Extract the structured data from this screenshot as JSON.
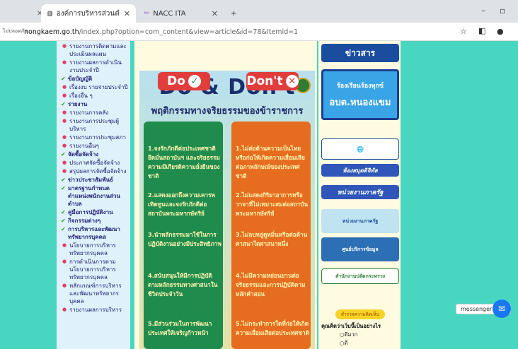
{
  "tabs": [
    {
      "label": "องค์การบริหารส่วนตำบลหนองแขม :: ...",
      "favicon": "globe-icon"
    },
    {
      "label": "NACC ITA",
      "favicon": "nacc-icon"
    }
  ],
  "address": {
    "secure_label": "ไม่ปลอดภัย",
    "host": "nongkaem.go.th",
    "path": "/index.php?option=com_content&view=article&id=78&Itemid=1"
  },
  "sidebar": {
    "items": [
      {
        "label": "รายงานการติดตามและประเมินผลแผน",
        "head": false
      },
      {
        "label": "รายงานผลการดำเนินงานประจำปี",
        "head": false
      },
      {
        "label": "ข้อบัญญัติ",
        "head": true
      },
      {
        "label": "เรื่องงบ รายจ่ายประจำปี",
        "head": false
      },
      {
        "label": "เรื่องอื่น ๆ",
        "head": false
      },
      {
        "label": "รายงาน",
        "head": true
      },
      {
        "label": "รายงานการคลัง",
        "head": false
      },
      {
        "label": "รายงานการประชุมผู้บริหาร",
        "head": false
      },
      {
        "label": "รายงานการประชุมสภา",
        "head": false
      },
      {
        "label": "รายงานอื่นๆ",
        "head": false
      },
      {
        "label": "จัดซื้อจัดจ้าง",
        "head": true
      },
      {
        "label": "ประกาศจัดซื้อจัดจ้าง",
        "head": false
      },
      {
        "label": "สรุปผลการจัดซื้อจัดจ้าง",
        "head": false
      },
      {
        "label": "ข่าวประชาสัมพันธ์",
        "head": true
      },
      {
        "label": "มาตรฐานกำหนดตำแหน่งพนักงานส่วนตำบล",
        "head": true
      },
      {
        "label": "คู่มือการปฏิบัติงาน",
        "head": true
      },
      {
        "label": "กิจกรรมต่างๆ",
        "head": true
      },
      {
        "label": "การบริหารและพัฒนาทรัพยากรบุคคล",
        "head": true
      },
      {
        "label": "นโยบายการบริหารทรัพยากรบุคคล",
        "head": false
      },
      {
        "label": "การดำเนินการตามนโยบายการบริหารทรัพยากรบุคคล",
        "head": false
      },
      {
        "label": "หลักเกณฑ์การบริหารและพัฒนาทรัพยากรบุคคล",
        "head": false
      },
      {
        "label": "รายงานผลการบริหาร",
        "head": false
      }
    ]
  },
  "poster": {
    "title": "Do & Don't",
    "subtitle": "พฤติกรรมทางจริยธรรมของข้าราชการ",
    "do_label": "Do",
    "dont_label": "Don't",
    "do_points": [
      "1.จงรักภักดีต่อประเทศชาติ ยึดมั่นสถาบันฯ และจริยธรรม ความมีเกียรติความยั่งยืนของชาติ",
      "2.แสดงออกถึงความเคารพ เทิดทูนและจงรักภักดีต่อสถาบันพระมหากษัตริย์",
      "3.นำหลักธรรมมาใช้ในการปฏิบัติงานอย่างมีประสิทธิภาพ",
      "4.สนับสนุนให้มีการปฏิบัติตามหลักธรรมทางศาสนาในชีวิตประจำวัน",
      "5.มีส่วนร่วมในการพัฒนาประเทศให้เจริญก้าวหน้า"
    ],
    "dont_points": [
      "1.ไม่ต่อต้านความเป็นไทย หรือก่อให้เกิดความเสื่อมเสียต่อภาพลักษณ์ของประเทศชาติ",
      "2.ไม่แสดงกิริยาอาการหรือวาจาที่ไม่เหมาะสมต่อสถาบันพระมหากษัตริย์",
      "3.ไม่ลบหลู่ดูหมิ่นหรือต่อต้านศาสนาใดศาสนาหนึ่ง",
      "4.ไม่มีความหย่อนยานต่อจริยธรรมและการปฏิบัติตามหลักคำสอน",
      "5.ไม่กระทำการใดที่ก่อให้เกิดความเสื่อมเสียต่อประเทศชาติ"
    ]
  },
  "right_banners": {
    "news": "ข่าวสาร",
    "complaint": "ร้องเรียนร้องทุกข์",
    "complaint_sub": "อบต.หนองแขม",
    "link1": "ห้องสมุดดิจิทัล",
    "link2": "หน่วยงานภาครัฐ",
    "link3": "หน่วยงานภาครัฐ",
    "link4": "ศูนย์บริการข้อมูล",
    "link5": "สำนักงานปลัดกระทรวง"
  },
  "survey": {
    "header": "สำรวจความคิดเห็น",
    "question": "คุณคิดว่าเว็บนี้เป็นอย่างไร",
    "options": [
      "ดีมาก",
      "ดี"
    ]
  },
  "chat": {
    "label": "messenger chat"
  },
  "colors": {
    "accent": "#1f8c4d",
    "dont": "#e66d20",
    "bg": "#49d6c0"
  }
}
